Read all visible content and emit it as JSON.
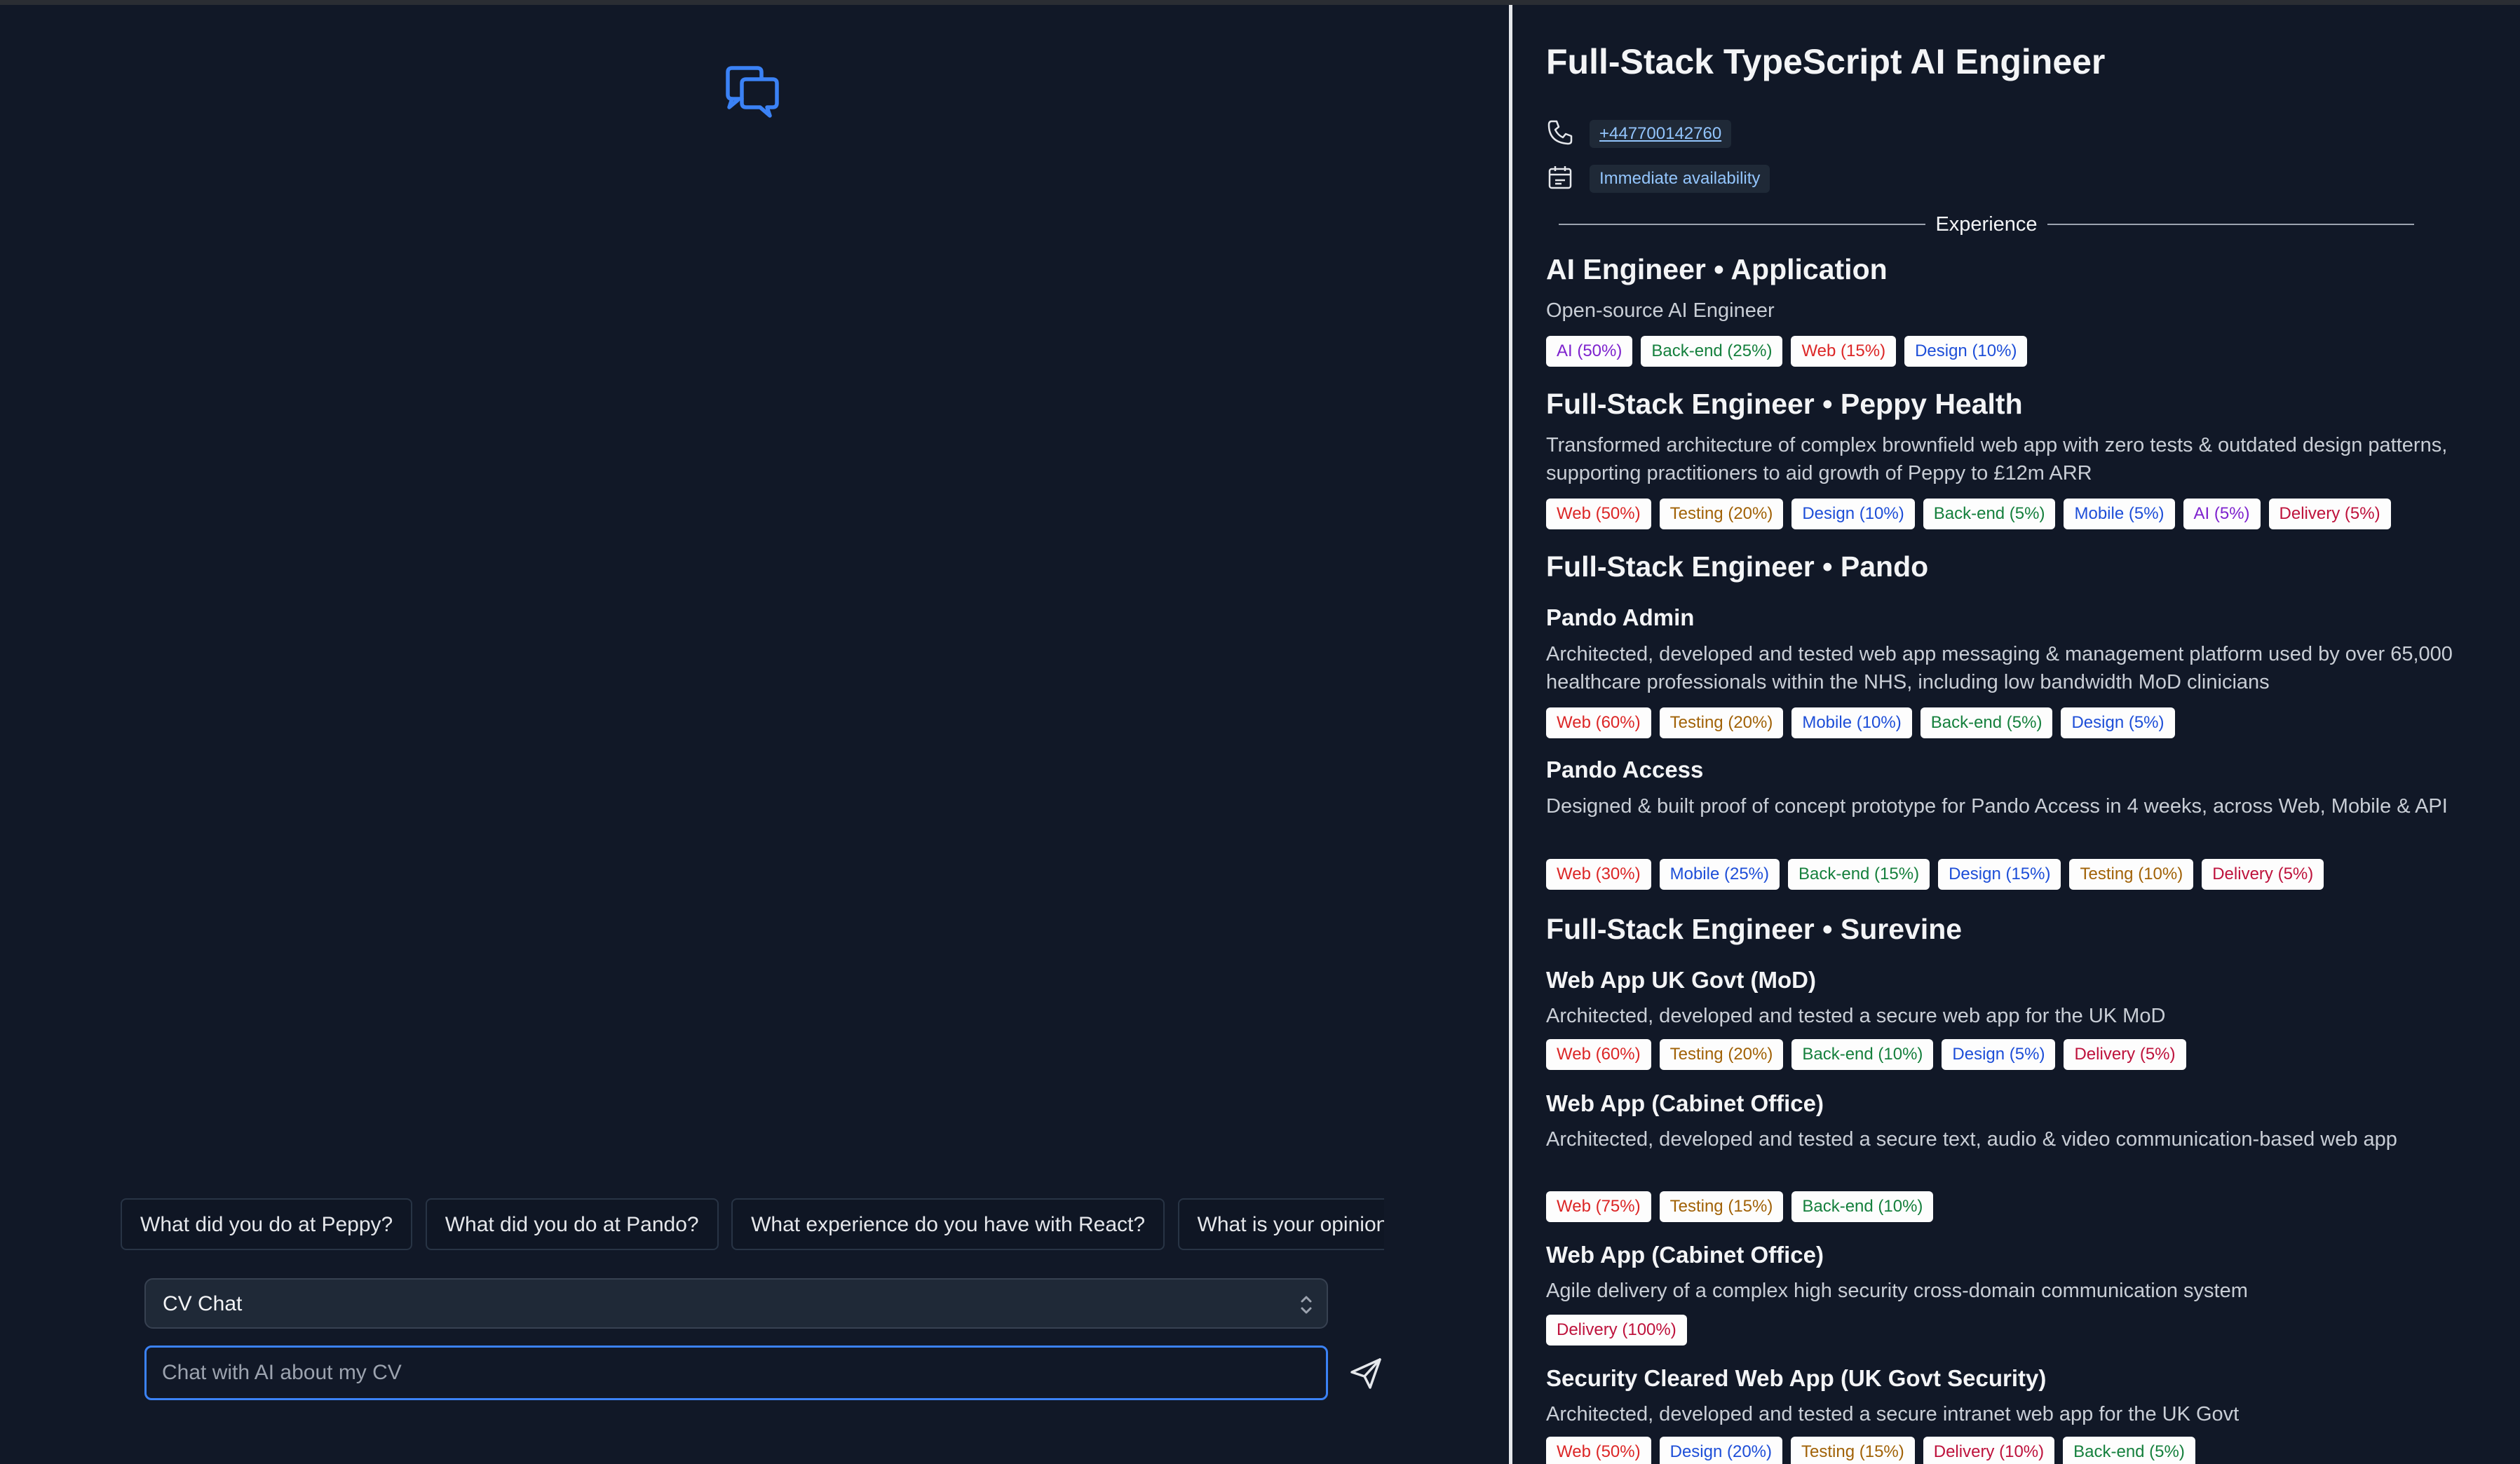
{
  "chat": {
    "suggestions": [
      "What did you do at Peppy?",
      "What did you do at Pando?",
      "What experience do you have with React?",
      "What is your opinion o"
    ],
    "model_select": {
      "selected": "CV Chat"
    },
    "input": {
      "placeholder": "Chat with AI about my CV",
      "value": ""
    },
    "icons": {
      "logo": "chat-bubbles-icon",
      "send": "send-icon",
      "select": "chevron-up-down-icon"
    },
    "accent_color": "#3b82f6"
  },
  "cv": {
    "title": "Full-Stack TypeScript AI Engineer",
    "phone": "+447700142760",
    "availability": "Immediate availability",
    "experience_heading": "Experience",
    "icons": {
      "phone": "phone-icon",
      "availability": "calendar-icon"
    },
    "roles": [
      {
        "title": "AI Engineer • Application",
        "description": "Open-source AI Engineer",
        "tags": [
          "AI (50%)",
          "Back-end (25%)",
          "Web (15%)",
          "Design (10%)"
        ]
      },
      {
        "title": "Full-Stack Engineer • Peppy Health",
        "description": "Transformed architecture of complex brownfield web app with zero tests & outdated design patterns, supporting practitioners to aid growth of Peppy to £12m ARR",
        "tags": [
          "Web (50%)",
          "Testing (20%)",
          "Design (10%)",
          "Back-end (5%)",
          "Mobile (5%)",
          "AI (5%)",
          "Delivery (5%)"
        ]
      },
      {
        "title": "Full-Stack Engineer • Pando",
        "projects": [
          {
            "name": "Pando Admin",
            "description": "Architected, developed and tested web app messaging & management platform used by over 65,000 healthcare professionals within the NHS, including low bandwidth MoD clinicians",
            "tags": [
              "Web (60%)",
              "Testing (20%)",
              "Mobile (10%)",
              "Back-end (5%)",
              "Design (5%)"
            ]
          },
          {
            "name": "Pando Access",
            "description": "Designed & built proof of concept prototype for Pando Access in 4 weeks, across Web, Mobile & API",
            "tags": [
              "Web (30%)",
              "Mobile (25%)",
              "Back-end (15%)",
              "Design (15%)",
              "Testing (10%)",
              "Delivery (5%)"
            ]
          }
        ]
      },
      {
        "title": "Full-Stack Engineer • Surevine",
        "projects": [
          {
            "name": "Web App UK Govt (MoD)",
            "description": "Architected, developed and tested a secure web app for the UK MoD",
            "tags": [
              "Web (60%)",
              "Testing (20%)",
              "Back-end (10%)",
              "Design (5%)",
              "Delivery (5%)"
            ]
          },
          {
            "name": "Web App (Cabinet Office)",
            "description": "Architected, developed and tested a secure text, audio & video communication-based web app",
            "tags": [
              "Web (75%)",
              "Testing (15%)",
              "Back-end (10%)"
            ]
          },
          {
            "name": "Web App (Cabinet Office)",
            "description": "Agile delivery of a complex high security cross-domain communication system",
            "tags": [
              "Delivery (100%)"
            ]
          },
          {
            "name": "Security Cleared Web App (UK Govt Security)",
            "description": "Architected, developed and tested a secure intranet web app for the UK Govt",
            "tags": [
              "Web (50%)",
              "Design (20%)",
              "Testing (15%)",
              "Delivery (10%)",
              "Back-end (5%)"
            ]
          }
        ]
      }
    ],
    "tag_colors": {
      "AI": "#7e22ce",
      "Back-end": "#15803d",
      "Web": "#dc2626",
      "Design": "#1d4ed8",
      "Testing": "#a16207",
      "Mobile": "#1d4ed8",
      "Delivery": "#be123c"
    }
  }
}
